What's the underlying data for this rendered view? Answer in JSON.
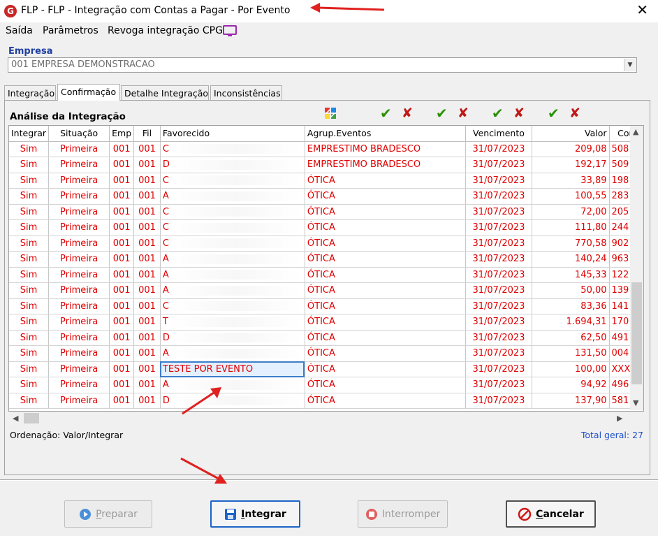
{
  "window": {
    "logo": "G",
    "title": "FLP -  FLP - Integração com Contas a Pagar - Por Evento",
    "close_glyph": "✕"
  },
  "menu": {
    "items": [
      "Saída",
      "Parâmetros",
      "Revoga integração CPG"
    ],
    "extra_icon": "screen-icon"
  },
  "empresa": {
    "label": "Empresa",
    "value": "001 EMPRESA DEMONSTRACAO"
  },
  "tabs": [
    "Integração",
    "Confirmação",
    "Detalhe Integração",
    "Inconsistências"
  ],
  "active_tab": "Confirmação",
  "section": {
    "title": "Análise da Integração"
  },
  "grid": {
    "columns": [
      "Integrar",
      "Situação",
      "Emp",
      "Fil",
      "Favorecido",
      "Agrup.Eventos",
      "Vencimento",
      "Valor",
      "Con"
    ],
    "rows": [
      [
        "Sim",
        "Primeira",
        "001",
        "001",
        "C",
        "EMPRESTIMO BRADESCO",
        "31/07/2023",
        "209,08",
        "508"
      ],
      [
        "Sim",
        "Primeira",
        "001",
        "001",
        "D",
        "EMPRESTIMO BRADESCO",
        "31/07/2023",
        "192,17",
        "509"
      ],
      [
        "Sim",
        "Primeira",
        "001",
        "001",
        "C",
        "ÓTICA",
        "31/07/2023",
        "33,89",
        "198"
      ],
      [
        "Sim",
        "Primeira",
        "001",
        "001",
        "A",
        "ÓTICA",
        "31/07/2023",
        "100,55",
        "283"
      ],
      [
        "Sim",
        "Primeira",
        "001",
        "001",
        "C",
        "ÓTICA",
        "31/07/2023",
        "72,00",
        "205"
      ],
      [
        "Sim",
        "Primeira",
        "001",
        "001",
        "C",
        "ÓTICA",
        "31/07/2023",
        "111,80",
        "244"
      ],
      [
        "Sim",
        "Primeira",
        "001",
        "001",
        "C",
        "ÓTICA",
        "31/07/2023",
        "770,58",
        "902"
      ],
      [
        "Sim",
        "Primeira",
        "001",
        "001",
        "A",
        "ÓTICA",
        "31/07/2023",
        "140,24",
        "963"
      ],
      [
        "Sim",
        "Primeira",
        "001",
        "001",
        "A",
        "ÓTICA",
        "31/07/2023",
        "145,33",
        "122"
      ],
      [
        "Sim",
        "Primeira",
        "001",
        "001",
        "A",
        "ÓTICA",
        "31/07/2023",
        "50,00",
        "139"
      ],
      [
        "Sim",
        "Primeira",
        "001",
        "001",
        "C",
        "ÓTICA",
        "31/07/2023",
        "83,36",
        "141"
      ],
      [
        "Sim",
        "Primeira",
        "001",
        "001",
        "T",
        "ÓTICA",
        "31/07/2023",
        "1.694,31",
        "170"
      ],
      [
        "Sim",
        "Primeira",
        "001",
        "001",
        "D",
        "ÓTICA",
        "31/07/2023",
        "62,50",
        "491"
      ],
      [
        "Sim",
        "Primeira",
        "001",
        "001",
        "A",
        "ÓTICA",
        "31/07/2023",
        "131,50",
        "004"
      ],
      [
        "Sim",
        "Primeira",
        "001",
        "001",
        "TESTE POR EVENTO",
        "ÓTICA",
        "31/07/2023",
        "100,00",
        "XXX"
      ],
      [
        "Sim",
        "Primeira",
        "001",
        "001",
        "A",
        "ÓTICA",
        "31/07/2023",
        "94,92",
        "496"
      ],
      [
        "Sim",
        "Primeira",
        "001",
        "001",
        "D",
        "ÓTICA",
        "31/07/2023",
        "137,90",
        "581"
      ]
    ],
    "selected_row": 14
  },
  "footer": {
    "ordenacao": "Ordenação: Valor/Integrar",
    "total": "Total geral: 27"
  },
  "buttons": [
    {
      "label": "Preparar",
      "mnemonic": "P",
      "icon": "play-icon",
      "enabled": false
    },
    {
      "label": "Integrar",
      "mnemonic": "I",
      "icon": "save-icon",
      "enabled": true
    },
    {
      "label": "Interromper",
      "mnemonic": "",
      "icon": "stop-icon",
      "enabled": false
    },
    {
      "label": "Cancelar",
      "mnemonic": "C",
      "icon": "cancel-icon",
      "enabled": true
    }
  ],
  "colors": {
    "row_text": "#e00000",
    "label_blue": "#1f3fa0",
    "total_blue": "#1e50c8",
    "check_green": "#2a8f00",
    "cross_red": "#c01818",
    "annotation_arrow": "#e0211f"
  }
}
